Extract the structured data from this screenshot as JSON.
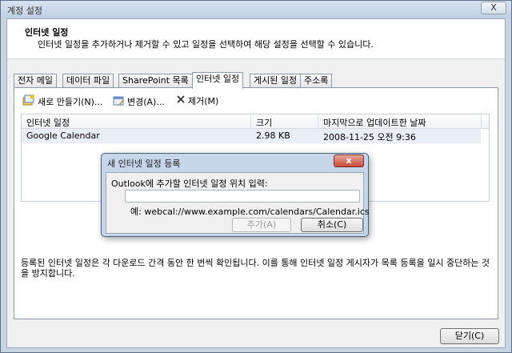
{
  "window": {
    "title": "계정 설정",
    "close_label": "X"
  },
  "header": {
    "title": "인터넷 일정",
    "description": "인터넷 일정을 추가하거나 제거할 수 있고 일정을 선택하여 해당 설정을 선택할 수 있습니다."
  },
  "tabs": [
    {
      "label": "전자 메일",
      "active": false
    },
    {
      "label": "데이터 파일",
      "active": false
    },
    {
      "label": "SharePoint 목록",
      "active": false
    },
    {
      "label": "인터넷 일정",
      "active": true
    },
    {
      "label": "게시된 일정",
      "active": false
    },
    {
      "label": "주소록",
      "active": false
    }
  ],
  "toolbar": {
    "new_label": "새로 만들기(N)...",
    "change_label": "변경(A)...",
    "remove_label": "제거(M)",
    "icons": [
      "new-calendar-icon",
      "change-calendar-icon",
      "remove-x-icon"
    ]
  },
  "list": {
    "columns": [
      "인터넷 일정",
      "크기",
      "마지막으로 업데이트한 날짜"
    ],
    "rows": [
      {
        "name": "Google Calendar",
        "size": "2.98 KB",
        "updated": "2008-11-25 오전 9:36"
      }
    ]
  },
  "panel_note": "등록된 인터넷 일정은 각 다운로드 간격 동안 한 번씩 확인됩니다. 이를 통해 인터넷 일정 게시자가 목록 등록을 일시 중단하는 것을 방지합니다.",
  "footer": {
    "close_label": "닫기(C)"
  },
  "dialog": {
    "title": "새 인터넷 일정 등록",
    "close_label": "x",
    "label": "Outlook에 추가할 인터넷 일정 위치 입력:",
    "input_value": "",
    "example": "예: webcal://www.example.com/calendars/Calendar.ics",
    "add_label": "추가(A)",
    "cancel_label": "취소(C)"
  }
}
